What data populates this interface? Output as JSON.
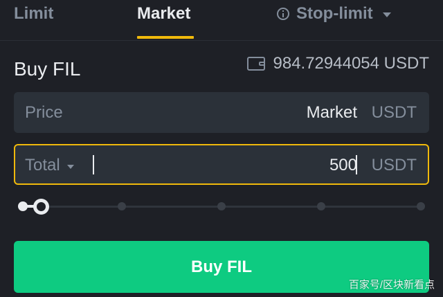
{
  "tabs": {
    "limit": "Limit",
    "market": "Market",
    "stop_limit": "Stop-limit",
    "active": "Market"
  },
  "form": {
    "title": "Buy FIL",
    "balance": "984.72944054 USDT",
    "price": {
      "label": "Price",
      "value": "Market",
      "unit": "USDT"
    },
    "total": {
      "label": "Total",
      "value": "500",
      "unit": "USDT"
    },
    "slider": {
      "level_percent": 0,
      "nodes": 5
    },
    "submit_label": "Buy FIL"
  },
  "watermark": "百家号/区块新看点",
  "colors": {
    "background": "#1e2026",
    "field": "#2b3139",
    "accent": "#f0b90b",
    "buy": "#0ecb81",
    "muted": "#848e9c",
    "text": "#eaecef"
  },
  "icons": {
    "stop_limit_info": "info-icon",
    "stop_limit_dropdown": "chevron-down-icon",
    "balance": "wallet-icon",
    "total_dropdown": "chevron-down-icon"
  }
}
